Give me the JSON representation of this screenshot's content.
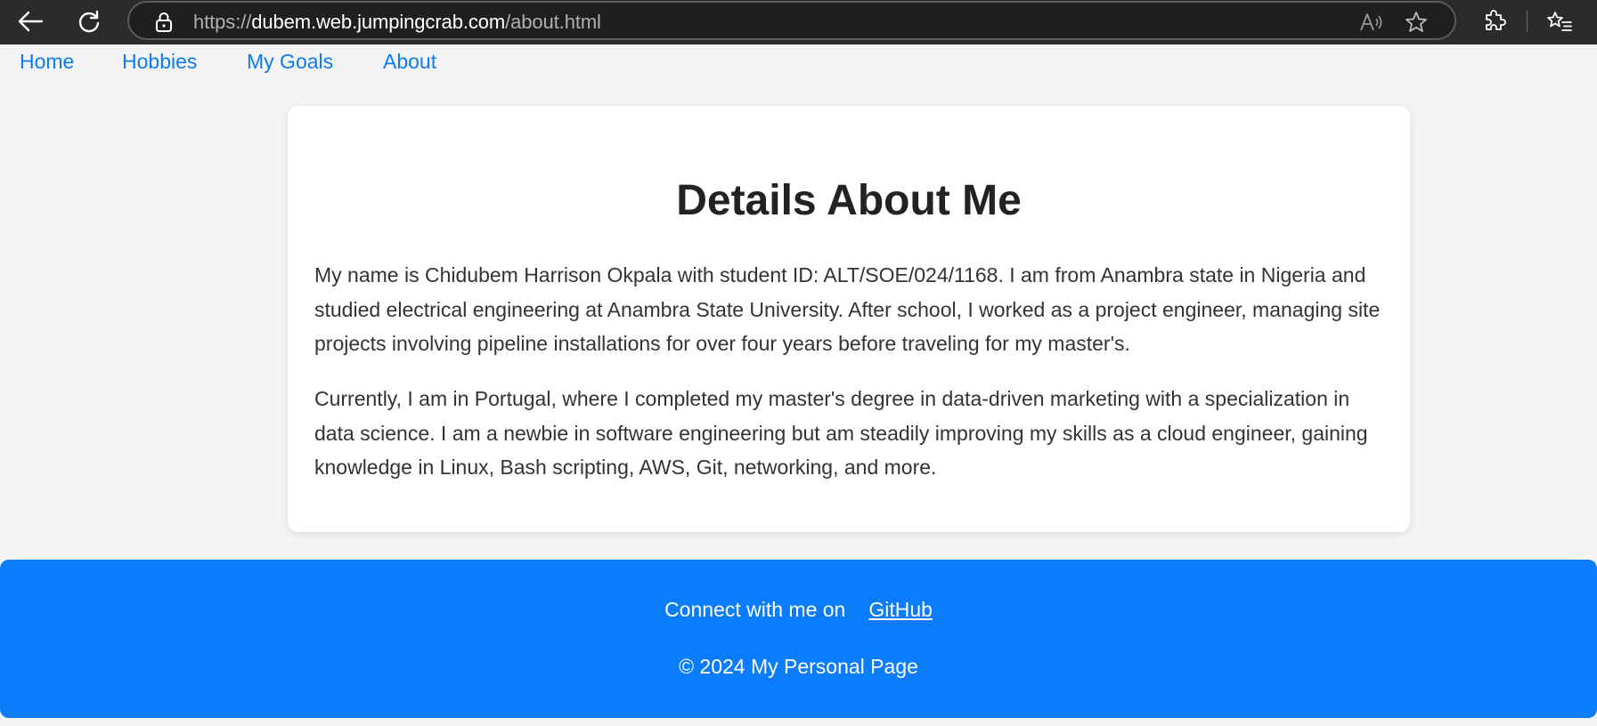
{
  "browser": {
    "url_scheme": "https://",
    "url_host": "dubem.web.jumpingcrab.com",
    "url_path": "/about.html",
    "icons": [
      "back-arrow-icon",
      "refresh-icon",
      "lock-icon",
      "read-aloud-icon",
      "favorite-star-icon",
      "extensions-icon",
      "favorites-icon"
    ]
  },
  "nav": {
    "items": [
      {
        "label": "Home"
      },
      {
        "label": "Hobbies"
      },
      {
        "label": "My Goals"
      },
      {
        "label": "About"
      }
    ]
  },
  "main": {
    "title": "Details About Me",
    "paragraphs": [
      "My name is Chidubem Harrison Okpala with student ID: ALT/SOE/024/1168. I am from Anambra state in Nigeria and studied electrical engineering at Anambra State University. After school, I worked as a project engineer, managing site projects involving pipeline installations for over four years before traveling for my master's.",
      "Currently, I am in Portugal, where I completed my master's degree in data-driven marketing with a specialization in data science. I am a newbie in software engineering but am steadily improving my skills as a cloud engineer, gaining knowledge in Linux, Bash scripting, AWS, Git, networking, and more."
    ]
  },
  "footer": {
    "connect_text": "Connect with me on",
    "github_label": "GitHub",
    "copyright": "© 2024 My Personal Page"
  },
  "colors": {
    "link": "#0a7cf0",
    "footer_bg": "#0a7cfc",
    "page_bg": "#f4f4f6",
    "chrome_bg": "#2b2b2b"
  }
}
